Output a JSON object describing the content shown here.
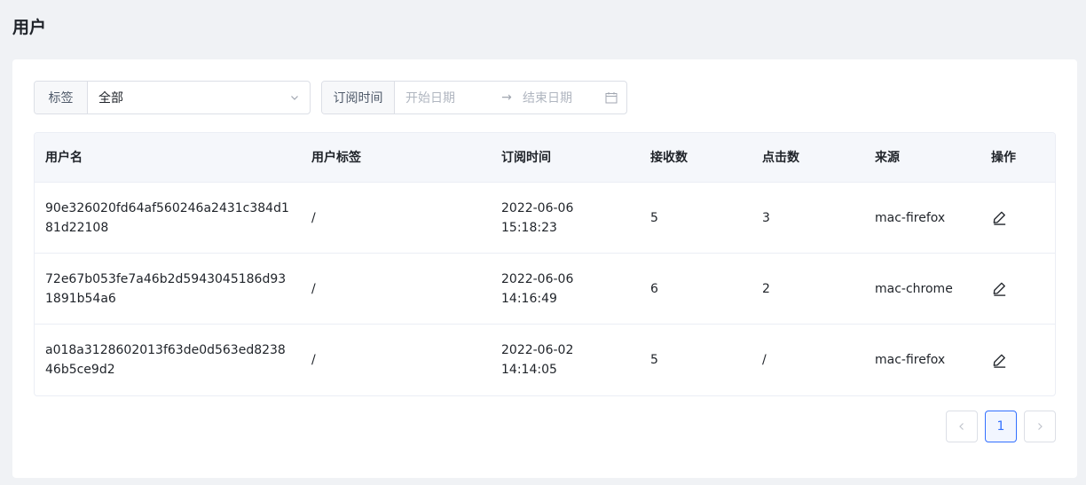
{
  "page": {
    "title": "用户"
  },
  "filters": {
    "tag_label": "标签",
    "tag_value": "全部",
    "subscribe_label": "订阅时间",
    "start_placeholder": "开始日期",
    "arrow": "→",
    "end_placeholder": "结束日期"
  },
  "table": {
    "headers": [
      "用户名",
      "用户标签",
      "订阅时间",
      "接收数",
      "点击数",
      "来源",
      "操作"
    ],
    "rows": [
      {
        "username": "90e326020fd64af560246a2431c384d181d22108",
        "tag": "/",
        "date": "2022-06-06",
        "time": "15:18:23",
        "received": "5",
        "clicks": "3",
        "source": "mac-firefox"
      },
      {
        "username": "72e67b053fe7a46b2d5943045186d931891b54a6",
        "tag": "/",
        "date": "2022-06-06",
        "time": "14:16:49",
        "received": "6",
        "clicks": "2",
        "source": "mac-chrome"
      },
      {
        "username": "a018a3128602013f63de0d563ed823846b5ce9d2",
        "tag": "/",
        "date": "2022-06-02",
        "time": "14:14:05",
        "received": "5",
        "clicks": "/",
        "source": "mac-firefox"
      }
    ]
  },
  "pagination": {
    "current": "1",
    "prev_icon": "chevron-left-icon",
    "next_icon": "chevron-right-icon"
  },
  "colors": {
    "accent": "#3370ff",
    "header_bg": "#f5f7fb",
    "page_bg": "#f0f2f5"
  }
}
